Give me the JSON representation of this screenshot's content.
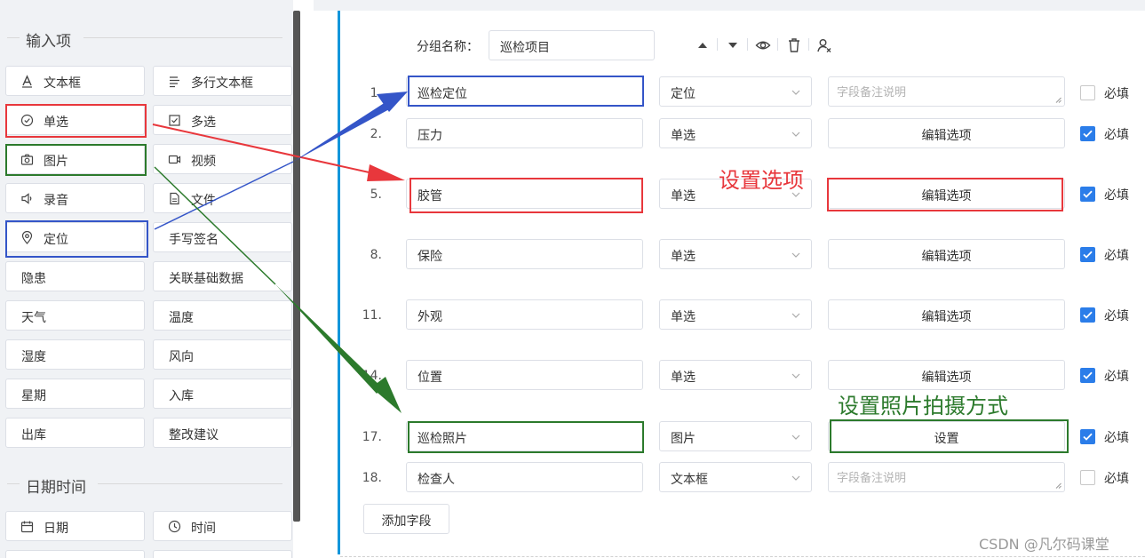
{
  "palette": {
    "input_section_title": "输入项",
    "datetime_section_title": "日期时间",
    "items": [
      {
        "label": "文本框",
        "icon": "text-a-icon"
      },
      {
        "label": "多行文本框",
        "icon": "align-left-icon"
      },
      {
        "label": "单选",
        "icon": "radio-check-icon"
      },
      {
        "label": "多选",
        "icon": "checkbox-icon"
      },
      {
        "label": "图片",
        "icon": "camera-icon"
      },
      {
        "label": "视频",
        "icon": "video-icon"
      },
      {
        "label": "录音",
        "icon": "speaker-icon"
      },
      {
        "label": "文件",
        "icon": "file-icon"
      },
      {
        "label": "定位",
        "icon": "location-pin-icon"
      },
      {
        "label": "手写签名",
        "icon": ""
      },
      {
        "label": "隐患",
        "icon": ""
      },
      {
        "label": "关联基础数据",
        "icon": ""
      },
      {
        "label": "天气",
        "icon": ""
      },
      {
        "label": "温度",
        "icon": ""
      },
      {
        "label": "湿度",
        "icon": ""
      },
      {
        "label": "风向",
        "icon": ""
      },
      {
        "label": "星期",
        "icon": ""
      },
      {
        "label": "入库",
        "icon": ""
      },
      {
        "label": "出库",
        "icon": ""
      },
      {
        "label": "整改建议",
        "icon": ""
      }
    ],
    "datetime_items": [
      {
        "label": "日期",
        "icon": "calendar-icon"
      },
      {
        "label": "时间",
        "icon": "clock-icon"
      }
    ]
  },
  "group": {
    "label": "分组名称：",
    "value": "巡检项目",
    "tools": [
      "move-up-icon",
      "move-down-icon",
      "eye-icon",
      "trash-icon",
      "user-permission-icon"
    ]
  },
  "fields": [
    {
      "num": "1.",
      "name": "巡检定位",
      "type": "定位",
      "extra": "字段备注说明",
      "extra_kind": "placeholder",
      "required": false,
      "required_label": "必填"
    },
    {
      "num": "2.",
      "name": "压力",
      "type": "单选",
      "extra": "编辑选项",
      "extra_kind": "button",
      "required": true,
      "required_label": "必填"
    },
    {
      "num": "5.",
      "name": "胶管",
      "type": "单选",
      "extra": "编辑选项",
      "extra_kind": "button",
      "required": true,
      "required_label": "必填"
    },
    {
      "num": "8.",
      "name": "保险",
      "type": "单选",
      "extra": "编辑选项",
      "extra_kind": "button",
      "required": true,
      "required_label": "必填"
    },
    {
      "num": "11.",
      "name": "外观",
      "type": "单选",
      "extra": "编辑选项",
      "extra_kind": "button",
      "required": true,
      "required_label": "必填"
    },
    {
      "num": "14.",
      "name": "位置",
      "type": "单选",
      "extra": "编辑选项",
      "extra_kind": "button",
      "required": true,
      "required_label": "必填"
    },
    {
      "num": "17.",
      "name": "巡检照片",
      "type": "图片",
      "extra": "设置",
      "extra_kind": "button",
      "required": true,
      "required_label": "必填"
    },
    {
      "num": "18.",
      "name": "检查人",
      "type": "文本框",
      "extra": "字段备注说明",
      "extra_kind": "placeholder",
      "required": false,
      "required_label": "必填"
    }
  ],
  "add_field_label": "添加字段",
  "annotations": {
    "set_options": "设置选项",
    "set_photo_mode": "设置照片拍摄方式"
  },
  "watermark": "CSDN @凡尔码课堂",
  "colors": {
    "annotation_red": "#e8373c",
    "annotation_green": "#2c7a2c",
    "annotation_blue": "#3455c8",
    "checkbox_blue": "#2b7de9",
    "accent_line": "#1296db"
  }
}
